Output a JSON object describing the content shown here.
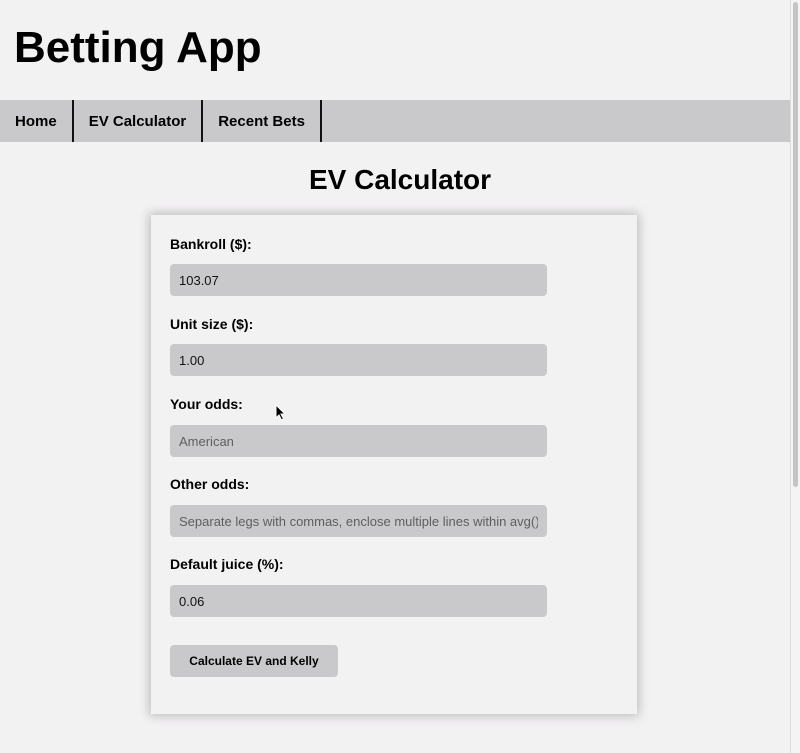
{
  "app": {
    "title": "Betting App"
  },
  "nav": {
    "items": [
      {
        "label": "Home"
      },
      {
        "label": "EV Calculator"
      },
      {
        "label": "Recent Bets"
      }
    ]
  },
  "page": {
    "title": "EV Calculator"
  },
  "form": {
    "bankroll": {
      "label": "Bankroll ($):",
      "value": "103.07",
      "placeholder": ""
    },
    "unit_size": {
      "label": "Unit size ($):",
      "value": "1.00",
      "placeholder": ""
    },
    "your_odds": {
      "label": "Your odds:",
      "value": "",
      "placeholder": "American"
    },
    "other_odds": {
      "label": "Other odds:",
      "value": "",
      "placeholder": "Separate legs with commas, enclose multiple lines within avg()"
    },
    "default_juice": {
      "label": "Default juice (%):",
      "value": "0.06",
      "placeholder": ""
    },
    "submit_label": "Calculate EV and Kelly"
  },
  "icons": {
    "pointer": "mouse-pointer-icon"
  },
  "colors": {
    "background": "#f3f2f3",
    "nav_background": "#c9c8ca",
    "input_background": "#c9c8ca",
    "text": "#000000"
  }
}
